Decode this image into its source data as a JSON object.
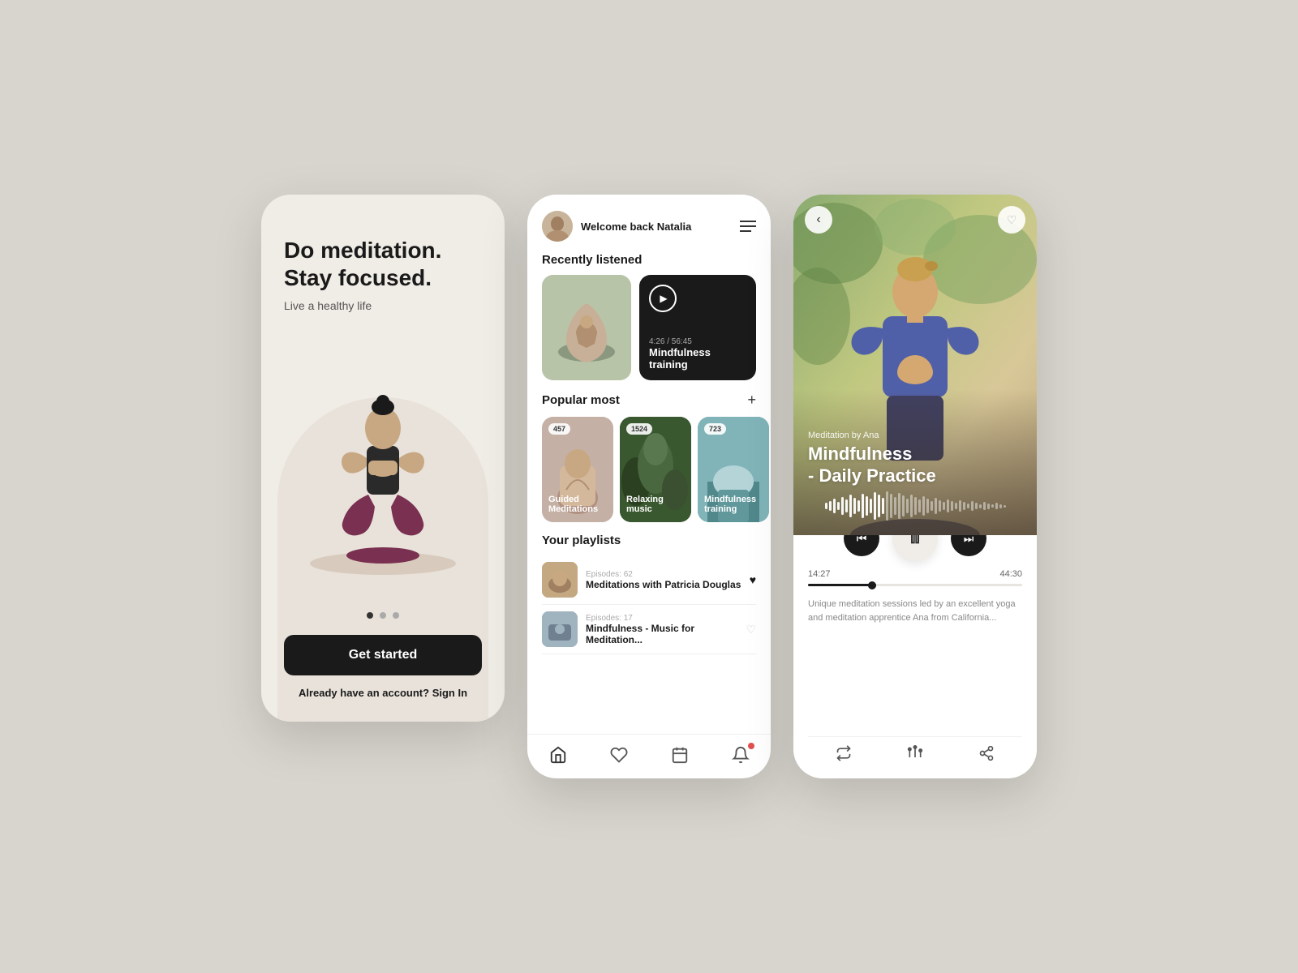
{
  "background_color": "#d8d5ce",
  "screen1": {
    "title_line1": "Do meditation.",
    "title_line2": "Stay focused.",
    "subtitle": "Live a healthy life",
    "cta_button": "Get started",
    "signin_prompt": "Already have an account?",
    "signin_link": "Sign In",
    "dots": [
      true,
      false,
      false
    ]
  },
  "screen2": {
    "welcome": "Welcome back Natalia",
    "recently_listened_title": "Recently listened",
    "playing_time": "4:26 / 56:45",
    "playing_title": "Mindfulness training",
    "popular_title": "Popular most",
    "popular_items": [
      {
        "badge": "457",
        "label": "Guided Meditations"
      },
      {
        "badge": "1524",
        "label": "Relaxing music"
      },
      {
        "badge": "723",
        "label": "Mindfulness training"
      }
    ],
    "playlists_title": "Your playlists",
    "playlists": [
      {
        "episodes": "Episodes: 62",
        "name": "Meditations with Patricia Douglas",
        "heart": "filled"
      },
      {
        "episodes": "Episodes: 17",
        "name": "Mindfulness - Music for Meditation...",
        "heart": "empty"
      }
    ],
    "nav": [
      "home",
      "heart",
      "calendar",
      "bell"
    ]
  },
  "screen3": {
    "back_label": "‹",
    "heart_label": "♡",
    "by_label": "Meditation by Ana",
    "track_title_line1": "Mindfulness",
    "track_title_line2": "- Daily Practice",
    "time_current": "14:27",
    "time_total": "44:30",
    "description": "Unique meditation sessions led by an excellent yoga and meditation apprentice Ana from California...",
    "actions": [
      "repeat",
      "equalizer",
      "share"
    ]
  }
}
